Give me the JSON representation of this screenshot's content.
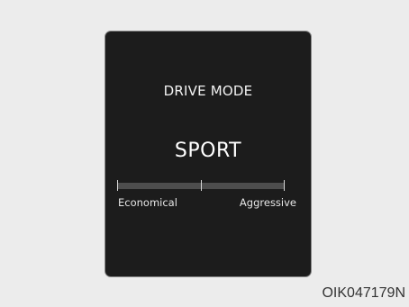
{
  "display": {
    "title": "DRIVE MODE",
    "mode": "SPORT",
    "scale": {
      "left_label": "Economical",
      "right_label": "Aggressive",
      "level": 0.5
    }
  },
  "figure_code": "OIK047179N",
  "colors": {
    "background": "#ececec",
    "screen": "#1c1c1c",
    "screen_text": "#f2f2f2",
    "bar": "#4d4d4d"
  }
}
